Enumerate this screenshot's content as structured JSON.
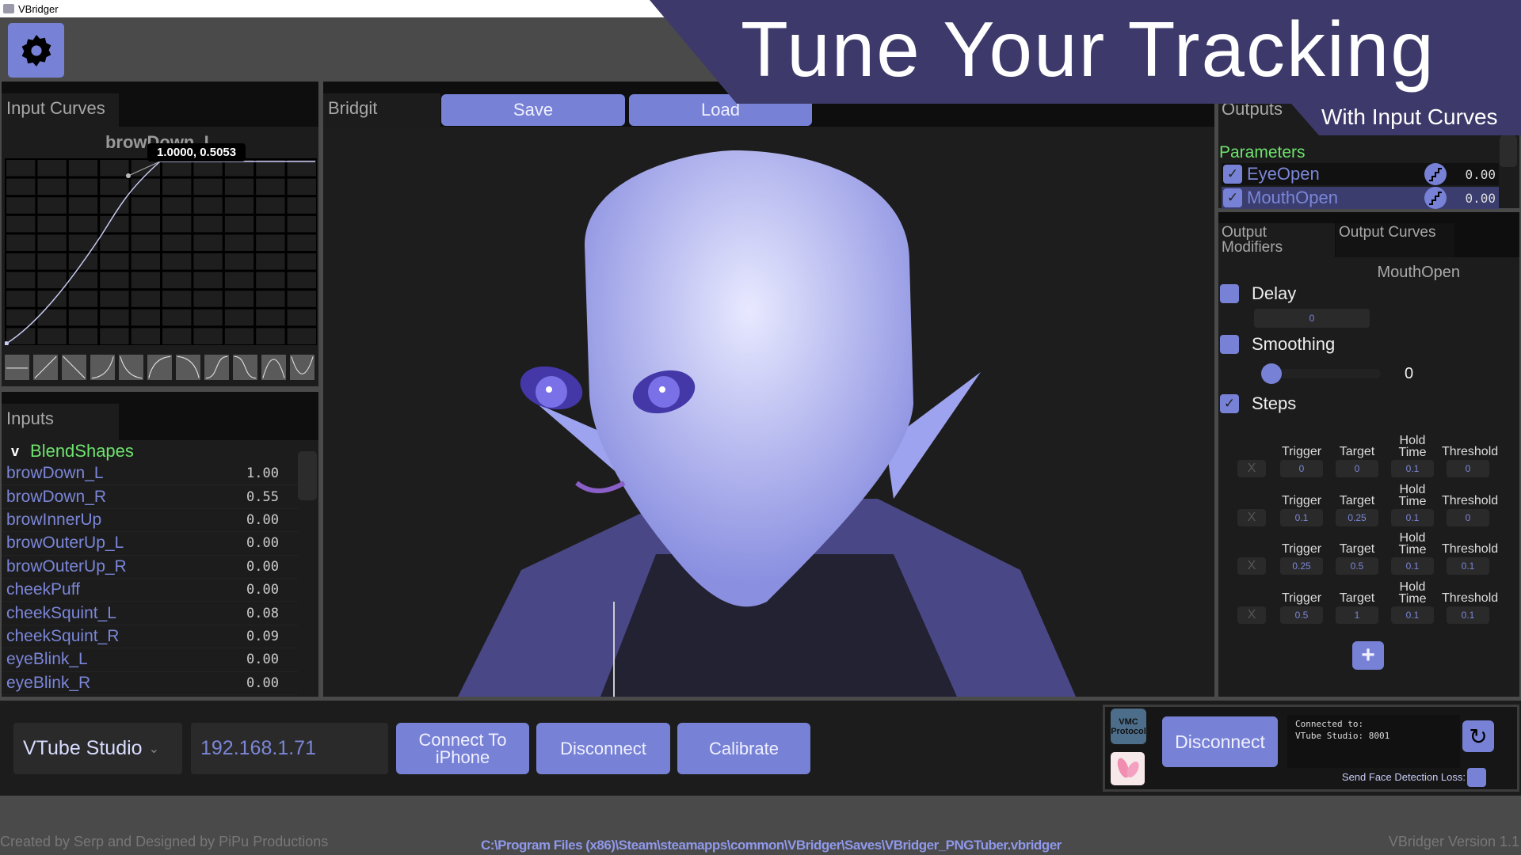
{
  "window": {
    "title": "VBridger"
  },
  "banner": {
    "title": "Tune Your Tracking",
    "subtitle": "With Input Curves",
    "color": "#3d3a6b"
  },
  "input_curves": {
    "tab": "Input Curves",
    "curve_name": "browDown_L",
    "tooltip": "1.0000, 0.5053",
    "presets": [
      "flat",
      "linear-up",
      "linear-down",
      "ease-in",
      "ease-in-down",
      "ease-out",
      "ease-out-down",
      "s-curve",
      "s-curve-down",
      "peak",
      "valley"
    ]
  },
  "inputs": {
    "tab": "Inputs",
    "group": "BlendShapes",
    "group_toggle": "v",
    "items": [
      {
        "name": "browDown_L",
        "value": "1.00"
      },
      {
        "name": "browDown_R",
        "value": "0.55"
      },
      {
        "name": "browInnerUp",
        "value": "0.00"
      },
      {
        "name": "browOuterUp_L",
        "value": "0.00"
      },
      {
        "name": "browOuterUp_R",
        "value": "0.00"
      },
      {
        "name": "cheekPuff",
        "value": "0.00"
      },
      {
        "name": "cheekSquint_L",
        "value": "0.08"
      },
      {
        "name": "cheekSquint_R",
        "value": "0.09"
      },
      {
        "name": "eyeBlink_L",
        "value": "0.00"
      },
      {
        "name": "eyeBlink_R",
        "value": "0.00"
      }
    ]
  },
  "viewport": {
    "tab": "Bridgit",
    "save": "Save",
    "load": "Load"
  },
  "outputs": {
    "tab": "Outputs",
    "section": "Parameters",
    "params": [
      {
        "name": "EyeOpen",
        "value": "0.00",
        "checked": true
      },
      {
        "name": "MouthOpen",
        "value": "0.00",
        "checked": true,
        "selected": true
      }
    ]
  },
  "modifiers": {
    "tabs": [
      "Output Modifiers",
      "Output Curves"
    ],
    "param": "MouthOpen",
    "delay": {
      "label": "Delay",
      "value": "0",
      "checked": false
    },
    "smoothing": {
      "label": "Smoothing",
      "value": "0",
      "checked": false
    },
    "steps": {
      "label": "Steps",
      "checked": true,
      "remove": "X",
      "headers": {
        "trigger": "Trigger",
        "target": "Target",
        "hold": "Hold Time",
        "threshold": "Threshold"
      },
      "rows": [
        {
          "trigger": "0",
          "target": "0",
          "hold": "0.1",
          "threshold": "0"
        },
        {
          "trigger": "0.1",
          "target": "0.25",
          "hold": "0.1",
          "threshold": "0"
        },
        {
          "trigger": "0.25",
          "target": "0.5",
          "hold": "0.1",
          "threshold": "0.1"
        },
        {
          "trigger": "0.5",
          "target": "1",
          "hold": "0.1",
          "threshold": "0.1"
        }
      ],
      "add": "+"
    }
  },
  "bottom": {
    "app_select": "VTube Studio",
    "ip": "192.168.1.71",
    "connect": "Connect To iPhone",
    "disconnect": "Disconnect",
    "calibrate": "Calibrate",
    "disconnect2": "Disconnect",
    "status_line1": "Connected to:",
    "status_line2": "VTube Studio: 8001",
    "face_loss": "Send Face Detection Loss:",
    "vmc_logo": "VMC Protocol"
  },
  "footer": {
    "credits": "Created by Serp and Designed by PiPu Productions",
    "path": "C:\\Program Files (x86)\\Steam\\steamapps\\common\\VBridger\\Saves\\VBridger_PNGTuber.vbridger",
    "version": "VBridger Version 1.1"
  }
}
